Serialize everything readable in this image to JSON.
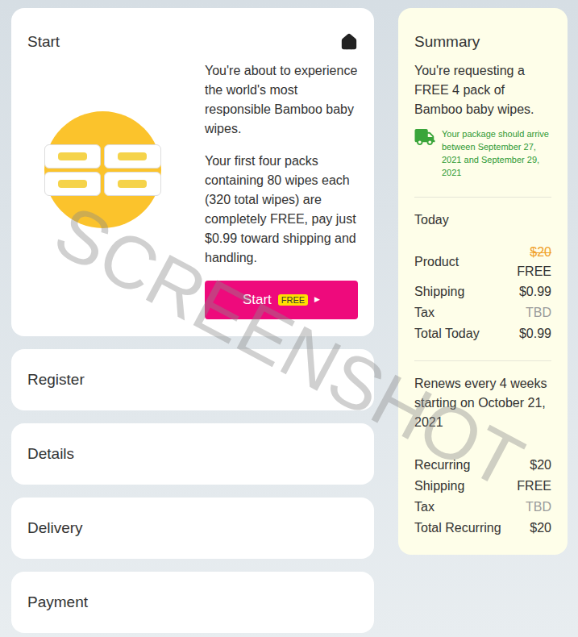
{
  "watermark": "SCREENSHOT",
  "steps": [
    {
      "title": "Start",
      "expanded": true
    },
    {
      "title": "Register",
      "expanded": false
    },
    {
      "title": "Details",
      "expanded": false
    },
    {
      "title": "Delivery",
      "expanded": false
    },
    {
      "title": "Payment",
      "expanded": false
    }
  ],
  "start": {
    "paragraphs": [
      "You're about to experience the world's most responsible Bamboo baby wipes.",
      "Your first four packs containing 80 wipes each (320 total wipes) are completely FREE, pay just $0.99 toward shipping and handling."
    ],
    "button": {
      "label": "Start",
      "badge": "FREE",
      "arrow": "▶"
    }
  },
  "summary": {
    "title": "Summary",
    "intro": "You're requesting a FREE 4 pack of Bamboo baby wipes.",
    "delivery": "Your package should arrive between September 27, 2021 and September 29, 2021",
    "today": {
      "heading": "Today",
      "rows": [
        {
          "label": "Product",
          "original": "$20",
          "value": "FREE",
          "muted": false
        },
        {
          "label": "Shipping",
          "original": "",
          "value": "$0.99",
          "muted": false
        },
        {
          "label": "Tax",
          "original": "",
          "value": "TBD",
          "muted": true
        },
        {
          "label": "Total Today",
          "original": "",
          "value": "$0.99",
          "muted": false
        }
      ]
    },
    "recurring": {
      "heading": "Renews every 4 weeks starting on October 21, 2021",
      "rows": [
        {
          "label": "Recurring",
          "original": "",
          "value": "$20",
          "muted": false
        },
        {
          "label": "Shipping",
          "original": "",
          "value": "FREE",
          "muted": false
        },
        {
          "label": "Tax",
          "original": "",
          "value": "TBD",
          "muted": true
        },
        {
          "label": "Total Recurring",
          "original": "",
          "value": "$20",
          "muted": false
        }
      ]
    }
  }
}
